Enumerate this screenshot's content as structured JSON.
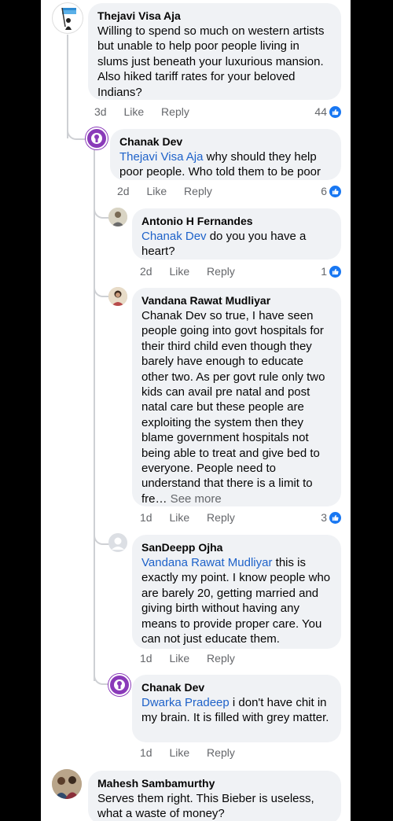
{
  "comments": [
    {
      "author": "Thejavi Visa Aja",
      "text": "Willing to spend so much on western artists but unable to help poor people living in slums just beneath your luxurious mansion. Also hiked tariff rates for your beloved Indians?",
      "time": "3d",
      "like": "Like",
      "reply": "Reply",
      "reactions": "44"
    },
    {
      "author": "Chanak Dev",
      "mention": "Thejavi Visa Aja",
      "text": " why should they help poor people.  Who told them to be poor",
      "time": "2d",
      "like": "Like",
      "reply": "Reply",
      "reactions": "6"
    },
    {
      "author": "Antonio H Fernandes",
      "mention": "Chanak Dev",
      "text": " do you you have a heart?",
      "time": "2d",
      "like": "Like",
      "reply": "Reply",
      "reactions": "1"
    },
    {
      "author": "Vandana Rawat Mudliyar",
      "text": "Chanak Dev so true, I have seen people going into govt hospitals for their third child even though they barely have enough to educate other two. As per govt rule only two kids can avail pre natal and post natal care but these people are exploiting the system then they blame government hospitals not being able to treat and give bed to everyone. People need to understand that there is a limit to fre…",
      "see_more": " See more",
      "time": "1d",
      "like": "Like",
      "reply": "Reply",
      "reactions": "3"
    },
    {
      "author": "SanDeepp Ojha",
      "mention": "Vandana Rawat Mudliyar",
      "text": " this is exactly my point. I know people who are barely 20, getting married and giving birth without having any means to provide proper care. You can not just educate them.",
      "time": "1d",
      "like": "Like",
      "reply": "Reply"
    },
    {
      "author": "Chanak Dev",
      "mention": "Dwarka Pradeep",
      "text": " i don't have chit in my brain.  It is filled with grey matter.",
      "time": "1d",
      "like": "Like",
      "reply": "Reply"
    },
    {
      "author": "Mahesh Sambamurthy",
      "text": "Serves them right. This Bieber is useless, what a waste of money?"
    }
  ],
  "colors": {
    "like_blue": "#1877f2",
    "mention_blue": "#1e62c9",
    "bubble_bg": "#f0f2f5",
    "meta_gray": "#65676b"
  }
}
